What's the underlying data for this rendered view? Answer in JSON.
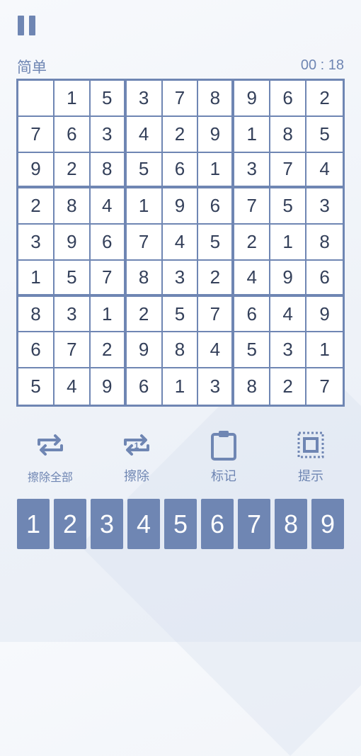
{
  "header": {
    "difficulty": "简单",
    "timer": "00 : 18"
  },
  "board": {
    "rows": [
      [
        "",
        "1",
        "5",
        "3",
        "7",
        "8",
        "9",
        "6",
        "2"
      ],
      [
        "7",
        "6",
        "3",
        "4",
        "2",
        "9",
        "1",
        "8",
        "5"
      ],
      [
        "9",
        "2",
        "8",
        "5",
        "6",
        "1",
        "3",
        "7",
        "4"
      ],
      [
        "2",
        "8",
        "4",
        "1",
        "9",
        "6",
        "7",
        "5",
        "3"
      ],
      [
        "3",
        "9",
        "6",
        "7",
        "4",
        "5",
        "2",
        "1",
        "8"
      ],
      [
        "1",
        "5",
        "7",
        "8",
        "3",
        "2",
        "4",
        "9",
        "6"
      ],
      [
        "8",
        "3",
        "1",
        "2",
        "5",
        "7",
        "6",
        "4",
        "9"
      ],
      [
        "6",
        "7",
        "2",
        "9",
        "8",
        "4",
        "5",
        "3",
        "1"
      ],
      [
        "5",
        "4",
        "9",
        "6",
        "1",
        "3",
        "8",
        "2",
        "7"
      ]
    ]
  },
  "tools": [
    {
      "label": "擦除全部",
      "icon": "erase-all-icon"
    },
    {
      "label": "擦除",
      "icon": "erase-icon"
    },
    {
      "label": "标记",
      "icon": "clipboard-icon"
    },
    {
      "label": "提示",
      "icon": "hint-icon"
    }
  ],
  "numpad": [
    "1",
    "2",
    "3",
    "4",
    "5",
    "6",
    "7",
    "8",
    "9"
  ],
  "colors": {
    "accent": "#6f86b3",
    "text": "#34405a",
    "background": "#f4f6fb"
  }
}
